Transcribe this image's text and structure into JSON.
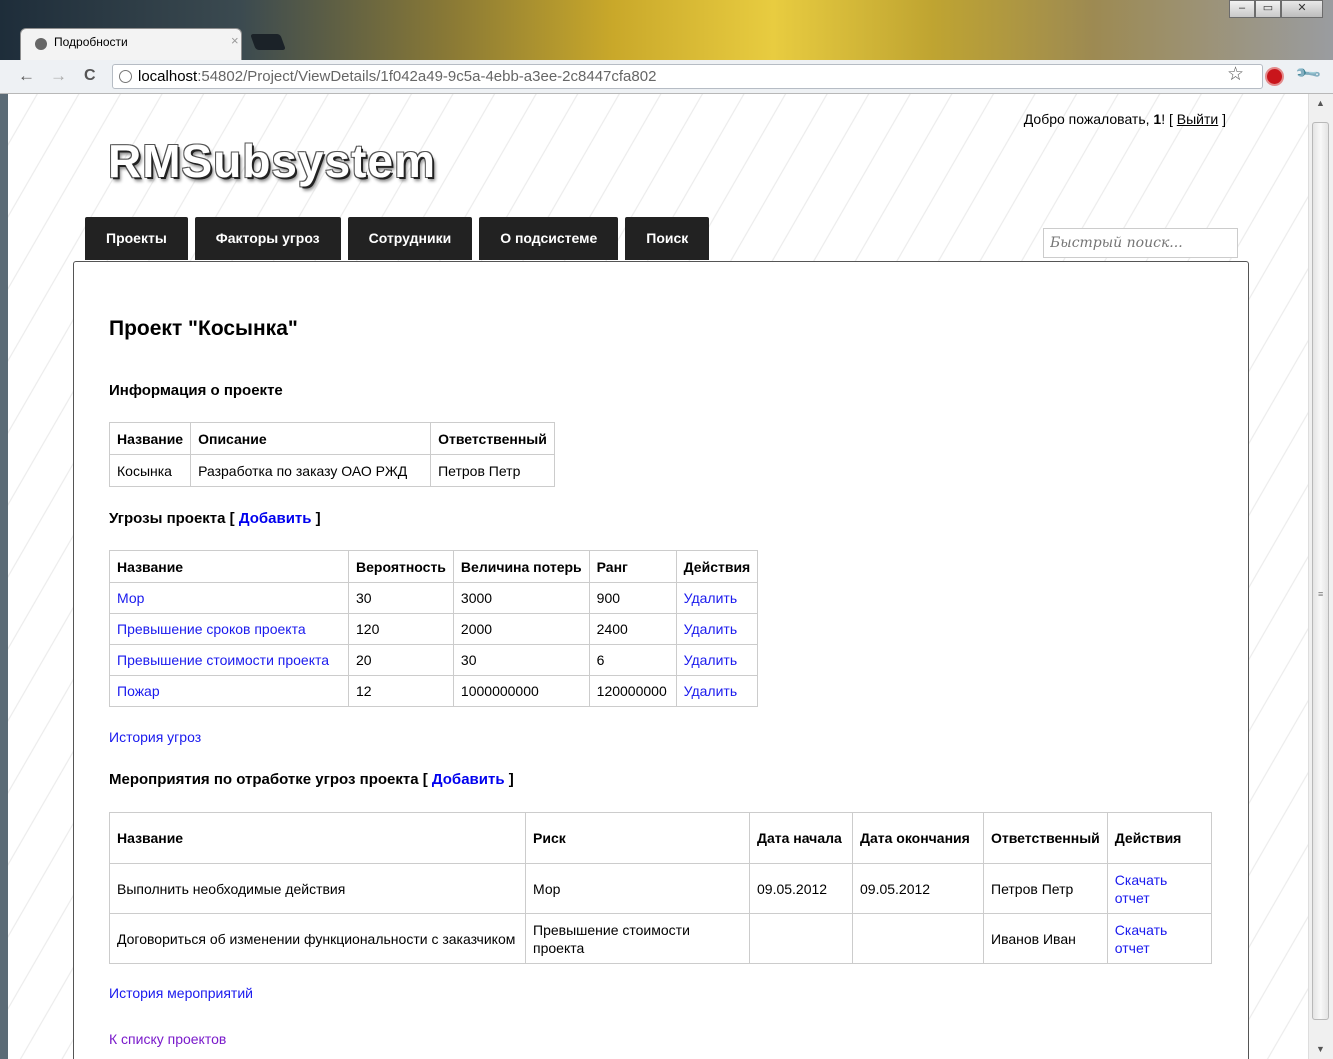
{
  "browser": {
    "tab_title": "Подробности",
    "tab_close": "×",
    "url_host": "localhost",
    "url_rest": ":54802/Project/ViewDetails/1f042a49-9c5a-4ebb-a3ee-2c8447cfa802",
    "back": "←",
    "forward": "→",
    "reload": "C",
    "star": "☆",
    "wrench": "🔧",
    "win_min": "–",
    "win_max": "▭",
    "win_close": "✕"
  },
  "header": {
    "welcome_prefix": "Добро пожаловать, ",
    "user": "1",
    "welcome_suffix": "! [ ",
    "logout": "Выйти",
    "welcome_end": " ]",
    "logo": "RMSubsystem"
  },
  "menu": [
    "Проекты",
    "Факторы угроз",
    "Сотрудники",
    "О подсистеме",
    "Поиск"
  ],
  "quick_search": {
    "placeholder": "Быстрый поиск..."
  },
  "page": {
    "title": "Проект \"Косынка\"",
    "info_heading": "Информация о проекте",
    "info_table": {
      "headers": [
        "Название",
        "Описание",
        "Ответственный"
      ],
      "row": [
        "Косынка",
        "Разработка по заказу ОАО РЖД",
        "Петров Петр"
      ]
    },
    "threats_heading": "Угрозы проекта [ ",
    "threats_add": "Добавить",
    "threats_heading_end": " ]",
    "threats_table": {
      "headers": [
        "Название",
        "Вероятность",
        "Величина потерь",
        "Ранг",
        "Действия"
      ],
      "rows": [
        [
          "Мор",
          "30",
          "3000",
          "900",
          "Удалить"
        ],
        [
          "Превышение сроков проекта",
          "120",
          "2000",
          "2400",
          "Удалить"
        ],
        [
          "Превышение стоимости проекта",
          "20",
          "30",
          "6",
          "Удалить"
        ],
        [
          "Пожар",
          "12",
          "1000000000",
          "120000000",
          "Удалить"
        ]
      ]
    },
    "threats_history": "История угроз",
    "measures_heading": "Мероприятия по отработке угроз проекта [ ",
    "measures_add": "Добавить",
    "measures_heading_end": " ]",
    "measures_table": {
      "headers": [
        "Название",
        "Риск",
        "Дата начала",
        "Дата окончания",
        "Ответственный",
        "Действия"
      ],
      "rows": [
        [
          "Выполнить необходимые действия",
          "Мор",
          "09.05.2012",
          "09.05.2012",
          "Петров Петр",
          "Скачать отчет"
        ],
        [
          "Договориться об изменении функциональности с заказчиком",
          "Превышение стоимости проекта",
          "",
          "",
          "Иванов Иван",
          "Скачать отчет"
        ]
      ]
    },
    "measures_history": "История мероприятий",
    "back_to_list": "К списку проектов"
  }
}
